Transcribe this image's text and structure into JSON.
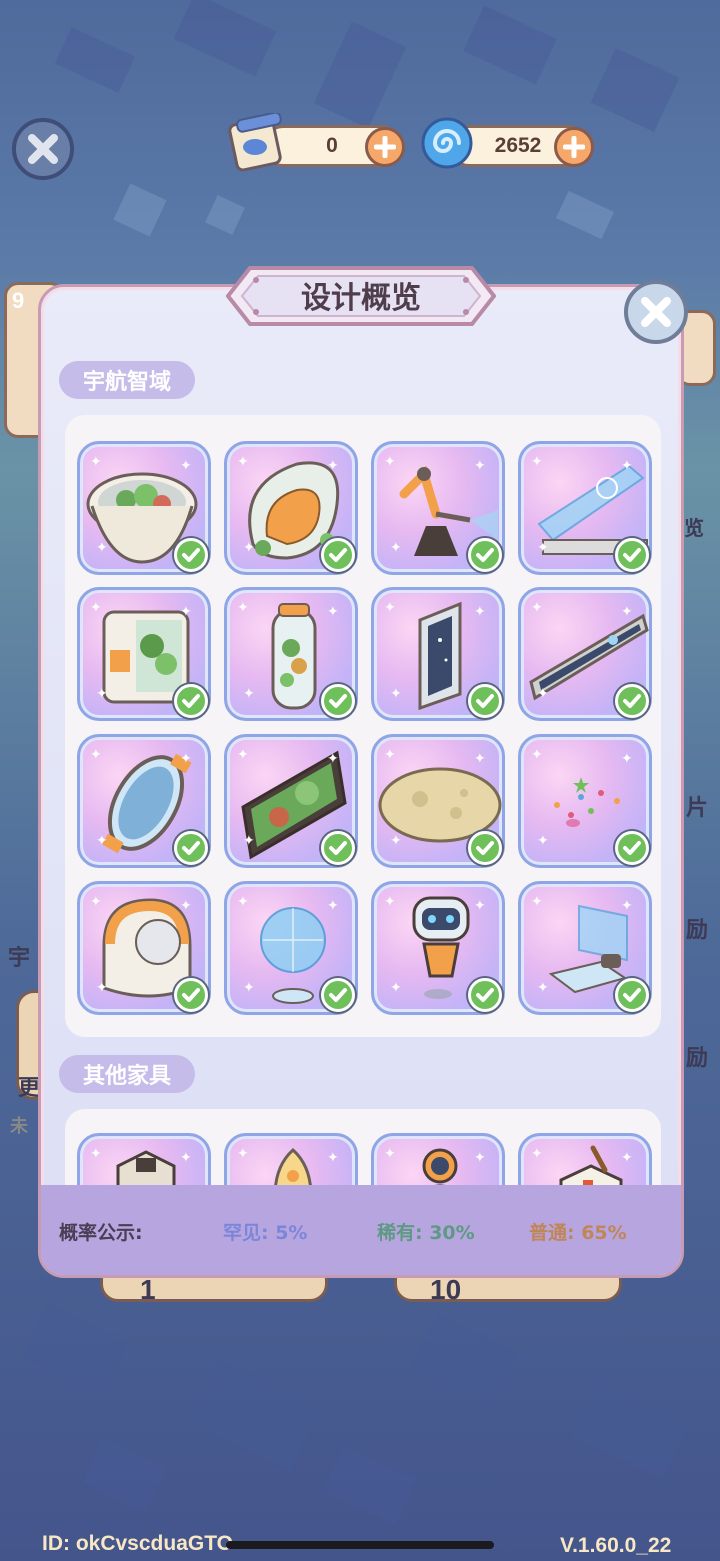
{
  "hud": {
    "ticket_count": "0",
    "spiral_count": "2652"
  },
  "background": {
    "left_number": "9",
    "left_label_1": "宇",
    "left_label_2": "更",
    "left_label_3": "未",
    "right_label_1": "览",
    "right_label_2": "片",
    "right_label_3": "励",
    "right_label_4": "励",
    "bottom_left_number": "1",
    "bottom_right_number": "10"
  },
  "panel": {
    "title": "设计概览",
    "sections": [
      {
        "label": "宇航智域",
        "items": [
          {
            "name": "terrarium-pod",
            "owned": true
          },
          {
            "name": "egg-chair",
            "owned": true
          },
          {
            "name": "robot-arm",
            "owned": true
          },
          {
            "name": "hologram-screen",
            "owned": true
          },
          {
            "name": "plant-cabinet",
            "owned": true
          },
          {
            "name": "plant-tube",
            "owned": true
          },
          {
            "name": "space-window",
            "owned": true
          },
          {
            "name": "long-window",
            "owned": true
          },
          {
            "name": "porthole-mirror",
            "owned": true
          },
          {
            "name": "plant-wall-frame",
            "owned": true
          },
          {
            "name": "moon-rug",
            "owned": true
          },
          {
            "name": "star-stickers",
            "owned": true
          },
          {
            "name": "capsule-bed",
            "owned": true
          },
          {
            "name": "hologram-globe",
            "owned": true
          },
          {
            "name": "robot-figure",
            "owned": true
          },
          {
            "name": "holo-laptop",
            "owned": true
          }
        ]
      },
      {
        "label": "其他家具",
        "items": [
          {
            "name": "tower-block"
          },
          {
            "name": "rocket"
          },
          {
            "name": "astronaut"
          },
          {
            "name": "cube-lamp"
          }
        ]
      }
    ],
    "footer": {
      "label": "概率公示:",
      "rare": "罕见: 5%",
      "uncommon": "稀有: 30%",
      "common": "普通: 65%"
    }
  },
  "bottom": {
    "id_text": "ID: okCvscduaGTO",
    "version": "V.1.60.0_22"
  },
  "colors": {
    "rare": "#7c86d8",
    "uncommon": "#5e9a83",
    "common": "#c08658",
    "check": "#6fbf5a"
  }
}
